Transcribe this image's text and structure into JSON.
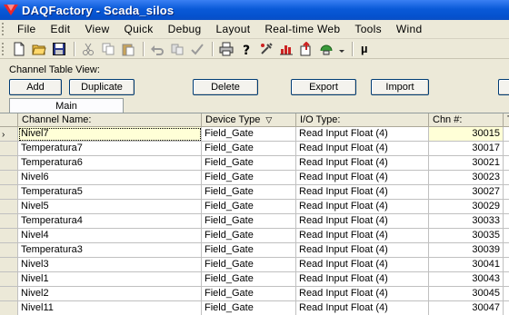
{
  "window": {
    "title": "DAQFactory - Scada_silos"
  },
  "menu": [
    "File",
    "Edit",
    "View",
    "Quick",
    "Debug",
    "Layout",
    "Real-time Web",
    "Tools",
    "Wind"
  ],
  "toolbar": {
    "trailing_glyph": "µ"
  },
  "channel_view": {
    "label": "Channel Table View:",
    "buttons": {
      "add": "Add",
      "duplicate": "Duplicate",
      "delete": "Delete",
      "export": "Export",
      "import": "Import"
    },
    "tab": "Main"
  },
  "table": {
    "columns": [
      "Channel Name:",
      "Device Type",
      "I/O Type:",
      "Chn #:",
      "T"
    ],
    "rows": [
      {
        "name": "Nivel7",
        "device": "Field_Gate",
        "io": "Read Input Float (4)",
        "chn": "30015"
      },
      {
        "name": "Temperatura7",
        "device": "Field_Gate",
        "io": "Read Input Float (4)",
        "chn": "30017"
      },
      {
        "name": "Temperatura6",
        "device": "Field_Gate",
        "io": "Read Input Float (4)",
        "chn": "30021"
      },
      {
        "name": "Nivel6",
        "device": "Field_Gate",
        "io": "Read Input Float (4)",
        "chn": "30023"
      },
      {
        "name": "Temperatura5",
        "device": "Field_Gate",
        "io": "Read Input Float (4)",
        "chn": "30027"
      },
      {
        "name": "Nivel5",
        "device": "Field_Gate",
        "io": "Read Input Float (4)",
        "chn": "30029"
      },
      {
        "name": "Temperatura4",
        "device": "Field_Gate",
        "io": "Read Input Float (4)",
        "chn": "30033"
      },
      {
        "name": "Nivel4",
        "device": "Field_Gate",
        "io": "Read Input Float (4)",
        "chn": "30035"
      },
      {
        "name": "Temperatura3",
        "device": "Field_Gate",
        "io": "Read Input Float (4)",
        "chn": "30039"
      },
      {
        "name": "Nivel3",
        "device": "Field_Gate",
        "io": "Read Input Float (4)",
        "chn": "30041"
      },
      {
        "name": "Nivel1",
        "device": "Field_Gate",
        "io": "Read Input Float (4)",
        "chn": "30043"
      },
      {
        "name": "Nivel2",
        "device": "Field_Gate",
        "io": "Read Input Float (4)",
        "chn": "30045"
      },
      {
        "name": "Nivel11",
        "device": "Field_Gate",
        "io": "Read Input Float (4)",
        "chn": "30047"
      }
    ]
  },
  "colors": {
    "title_bar": "#0a5ad8",
    "selected_cell": "#ffffd7",
    "app_icon": "#e8262a"
  }
}
